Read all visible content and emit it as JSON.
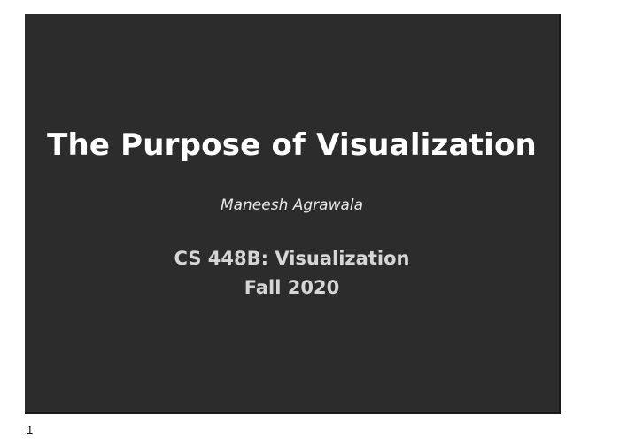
{
  "slide": {
    "title": "The Purpose of Visualization",
    "author": "Maneesh Agrawala",
    "course": "CS 448B: Visualization",
    "term": "Fall 2020"
  },
  "page_number": "1",
  "colors": {
    "slide_background": "#2c2c2c",
    "title_text": "#ffffff",
    "subtitle_text": "#d6d6d6",
    "page_background": "#ffffff"
  }
}
